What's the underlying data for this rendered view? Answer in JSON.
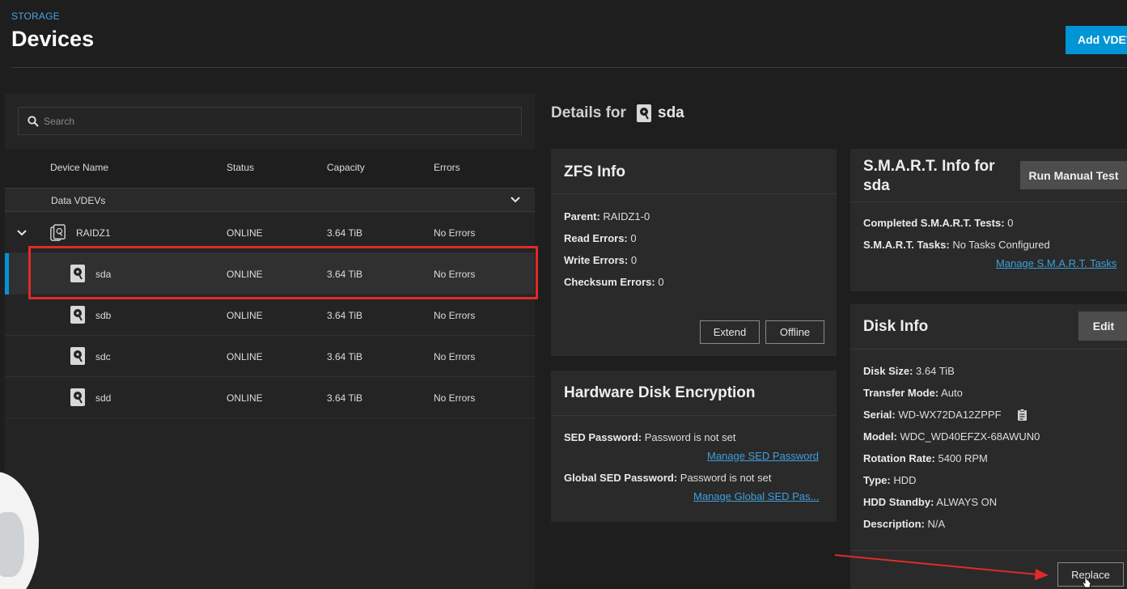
{
  "header": {
    "section": "STORAGE",
    "title": "Devices",
    "add_button": "Add VDEV"
  },
  "search": {
    "placeholder": "Search"
  },
  "table": {
    "columns": [
      "Device Name",
      "Status",
      "Capacity",
      "Errors"
    ],
    "group_label": "Data VDEVs",
    "vdev": {
      "name": "RAIDZ1",
      "status": "ONLINE",
      "capacity": "3.64 TiB",
      "errors": "No Errors"
    },
    "disks": [
      {
        "name": "sda",
        "status": "ONLINE",
        "capacity": "3.64 TiB",
        "errors": "No Errors"
      },
      {
        "name": "sdb",
        "status": "ONLINE",
        "capacity": "3.64 TiB",
        "errors": "No Errors"
      },
      {
        "name": "sdc",
        "status": "ONLINE",
        "capacity": "3.64 TiB",
        "errors": "No Errors"
      },
      {
        "name": "sdd",
        "status": "ONLINE",
        "capacity": "3.64 TiB",
        "errors": "No Errors"
      }
    ]
  },
  "details": {
    "prefix": "Details for",
    "disk": "sda"
  },
  "zfs": {
    "title": "ZFS Info",
    "parent_label": "Parent:",
    "parent": "RAIDZ1-0",
    "read_label": "Read Errors:",
    "read": "0",
    "write_label": "Write Errors:",
    "write": "0",
    "checksum_label": "Checksum Errors:",
    "checksum": "0",
    "extend": "Extend",
    "offline": "Offline"
  },
  "sed": {
    "title": "Hardware Disk Encryption",
    "sed_label": "SED Password:",
    "sed_value": "Password is not set",
    "manage_sed": "Manage SED Password",
    "global_label": "Global SED Password:",
    "global_value": "Password is not set",
    "manage_global": "Manage Global SED Pas..."
  },
  "smart": {
    "title_line1": "S.M.A.R.T. Info for",
    "title_line2": "sda",
    "run_test": "Run Manual Test",
    "completed_label": "Completed S.M.A.R.T. Tests:",
    "completed": "0",
    "tasks_label": "S.M.A.R.T. Tasks:",
    "tasks": "No Tasks Configured",
    "manage": "Manage S.M.A.R.T. Tasks"
  },
  "disk_info": {
    "title": "Disk Info",
    "edit": "Edit",
    "size_label": "Disk Size:",
    "size": "3.64 TiB",
    "transfer_label": "Transfer Mode:",
    "transfer": "Auto",
    "serial_label": "Serial:",
    "serial": "WD-WX72DA12ZPPF",
    "model_label": "Model:",
    "model": "WDC_WD40EFZX-68AWUN0",
    "rotation_label": "Rotation Rate:",
    "rotation": "5400 RPM",
    "type_label": "Type:",
    "type": "HDD",
    "standby_label": "HDD Standby:",
    "standby": "ALWAYS ON",
    "desc_label": "Description:",
    "desc": "N/A",
    "replace": "Replace"
  },
  "colors": {
    "accent": "#0095d5",
    "link": "#3f9fdc",
    "highlight": "#e02a2a"
  },
  "icons": [
    "search-icon",
    "chevron-down-icon",
    "disk-icon",
    "vdev-icon",
    "clipboard-icon",
    "cursor-icon"
  ]
}
